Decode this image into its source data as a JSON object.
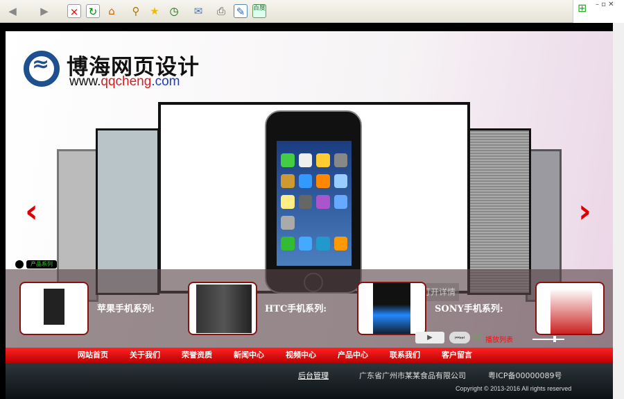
{
  "browser": {
    "icons": [
      "back-icon",
      "forward-icon",
      "stop-icon",
      "refresh-icon",
      "home-icon",
      "search-icon",
      "favorites-icon",
      "history-icon",
      "mail-icon",
      "print-icon",
      "edit-icon",
      "baidu-icon"
    ],
    "baidu_label": "百度"
  },
  "header": {
    "title": "博海网页设计",
    "url_prefix": "www.",
    "url_brand": "qqcheng",
    "url_suffix": ".com",
    "brand_color": "#d42020",
    "url_color": "#1a3ec0"
  },
  "carousel": {
    "badge": "产品系列",
    "open_details": "打开详情",
    "series": [
      {
        "label": "苹果手机系列:"
      },
      {
        "label": "HTC手机系列:"
      },
      {
        "label": "SONY手机系列:"
      }
    ],
    "playlist": "播放列表"
  },
  "nav": {
    "items": [
      "网站首页",
      "关于我们",
      "荣誉资质",
      "新闻中心",
      "视频中心",
      "产品中心",
      "联系我们",
      "客户留言"
    ]
  },
  "footer": {
    "admin": "后台管理",
    "company": "广东省广州市某某食品有限公司",
    "icp": "粤ICP备00000089号",
    "copyright": "Copyright © 2013-2016 All rights reserved"
  }
}
